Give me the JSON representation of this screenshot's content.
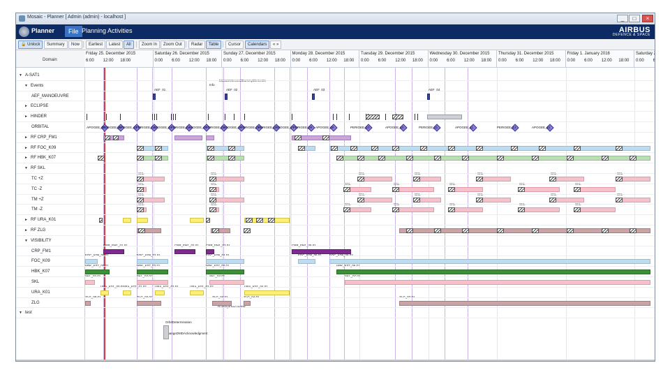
{
  "window": {
    "title": "Mosaic - Planner [ Admin (admin) - localhost ]"
  },
  "app": {
    "name": "Planner"
  },
  "menu": [
    "File",
    "Planning",
    "Activities"
  ],
  "brand": {
    "line1": "AIRBUS",
    "line2": "DEFENCE & SPACE"
  },
  "toolbar": {
    "unlock": "Unlock",
    "summary": "Summary",
    "now": "Now",
    "earliest": "Earliest",
    "latest": "Latest",
    "all": "All",
    "zoom_in": "Zoom In",
    "zoom_out": "Zoom Out",
    "radar": "Radar",
    "table": "Table",
    "cursor": "Cursor",
    "calendars": "Calendars",
    "more": "« »"
  },
  "left_header": "Domain",
  "days": [
    "Friday 25. December 2015",
    "Saturday 26. December 2015",
    "Sunday 27. December 2015",
    "Monday 28. December 2015",
    "Tuesday 29. December 2015",
    "Wednesday 30. December 2015",
    "Thursday 31. December 2015",
    "Friday 1. January 2016",
    "Saturday 2. January"
  ],
  "hours": [
    "6:00",
    "12:00",
    "18:00",
    "0:00"
  ],
  "last_hours": [
    "0:00",
    "6:00"
  ],
  "rows": [
    {
      "label": "A-SAT1",
      "arrow": "▼",
      "indent": 0
    },
    {
      "label": "Events",
      "arrow": "▼",
      "indent": 1
    },
    {
      "label": "AEF_MANOEUVRE",
      "arrow": "",
      "indent": 2
    },
    {
      "label": "ECLIPSE",
      "arrow": "►",
      "indent": 1
    },
    {
      "label": "HINDER",
      "arrow": "►",
      "indent": 1
    },
    {
      "label": "ORBITAL",
      "arrow": "",
      "indent": 2
    },
    {
      "label": "RF CRP_FM1",
      "arrow": "►",
      "indent": 1
    },
    {
      "label": "RF FOC_K09",
      "arrow": "►",
      "indent": 1
    },
    {
      "label": "RF HBK_K07",
      "arrow": "►",
      "indent": 1
    },
    {
      "label": "RF SKL",
      "arrow": "▼",
      "indent": 1
    },
    {
      "label": "TC +Z",
      "arrow": "",
      "indent": 2
    },
    {
      "label": "TC -Z",
      "arrow": "",
      "indent": 2
    },
    {
      "label": "TM +Z",
      "arrow": "",
      "indent": 2
    },
    {
      "label": "TM -Z",
      "arrow": "",
      "indent": 2
    },
    {
      "label": "RF URA_K01",
      "arrow": "►",
      "indent": 1
    },
    {
      "label": "RF ZLG",
      "arrow": "►",
      "indent": 1
    },
    {
      "label": "VISIBILITY",
      "arrow": "▼",
      "indent": 1
    },
    {
      "label": "CRP_FM1",
      "arrow": "",
      "indent": 2
    },
    {
      "label": "FOC_K09",
      "arrow": "",
      "indent": 2
    },
    {
      "label": "HBK_K07",
      "arrow": "",
      "indent": 2
    },
    {
      "label": "SKL",
      "arrow": "",
      "indent": 2
    },
    {
      "label": "URA_K01",
      "arrow": "",
      "indent": 2
    },
    {
      "label": "ZLG",
      "arrow": "",
      "indent": 2
    },
    {
      "label": "test",
      "arrow": "▼",
      "indent": 0
    }
  ],
  "events": {
    "aef": [
      "AEF_01",
      "AEF_02",
      "AEF_03",
      "AEF_04"
    ],
    "mosaic": "MosaicKSecondDummyElements",
    "info": "Info",
    "orbit_det": "OrbitDetermination",
    "ack": "ChangeDMDAcknowledgment",
    "dummy": "DummyKSecondOK"
  },
  "orbital_labels": [
    "APOGEE_02",
    "PERIGEE_02",
    "APOGEE_03",
    "PERIGEE_03",
    "APOGEE_04",
    "PERIGEE_04",
    "APOGEE_05",
    "PERIGEE_05",
    "APOGEE_06",
    "PERIGEE_06",
    "PERIGEE_07",
    "APOGEE_07",
    "PERIGEE_08",
    "APOGEE_09",
    "PERIGEE_10",
    "APOGEE_10",
    "PERIGEE_11",
    "APOGEE_11",
    "PERIGEE_12",
    "APOGEE_12"
  ],
  "vis_labels": {
    "crp": [
      "CRP_FM1_01.01",
      "CRP_FM1_02.01",
      "CRP_FM1_03.01",
      "CRP_FM1_05.01"
    ],
    "foc": [
      "FOC_K09_00.01",
      "FOC_K09_02.01",
      "FOC_K09_04.01",
      "FOC_K09_06.01",
      "FOC_K09_08.02"
    ],
    "hbk": [
      "HBK_K07_00.01",
      "HBK_K07_02.01",
      "HBK_K07_04.01",
      "HBK_K07_06.01"
    ],
    "skl": [
      "SKL_02.01",
      "SKL_03.01",
      "SKL_04.01",
      "SKL_07.01"
    ],
    "ura": [
      "URA_K01_00.01",
      "URA_K01_01.02",
      "URA_K01_02.01",
      "URA_K01_03.02",
      "URA_K01_04.01"
    ],
    "zlg": [
      "ZLG_00.01",
      "ZLG_02.01",
      "ZLG_04.01",
      "ZLG_04.01",
      "ZLG_07.01"
    ]
  },
  "skl_label": "SKL",
  "colors": {
    "menubar": "#0c2a63",
    "accent": "#3b73c4",
    "cursor": "#e03a3a",
    "visibility_line": "#b49ad8"
  }
}
